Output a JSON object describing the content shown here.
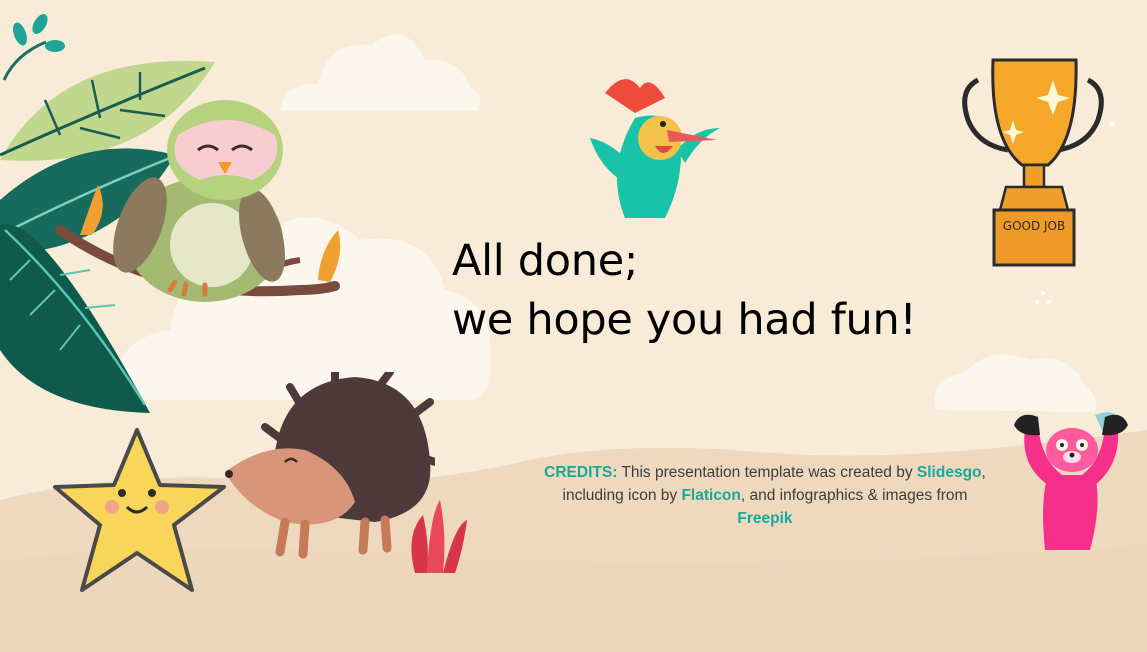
{
  "slide": {
    "title_line1": "All done;",
    "title_line2": "we hope you had fun!",
    "credits": {
      "label": "CREDITS:",
      "part1": " This presentation template was created by ",
      "link_slidesgo": "Slidesgo",
      "part2": ", including icon by ",
      "link_flaticon": "Flaticon",
      "part3": ", and infographics & images from ",
      "link_freepik": "Freepik"
    },
    "trophy_text": "GOOD JOB"
  },
  "colors": {
    "background": "#f8ecd8",
    "hill": "#eed9bf",
    "accent_teal": "#17a99a",
    "text": "#000000"
  },
  "icons": [
    "owl-illustration",
    "leaves-illustration",
    "woodpecker-illustration",
    "trophy-illustration",
    "hedgehog-illustration",
    "star-illustration",
    "pink-creature-illustration",
    "red-plant-illustration",
    "cloud-decoration"
  ]
}
